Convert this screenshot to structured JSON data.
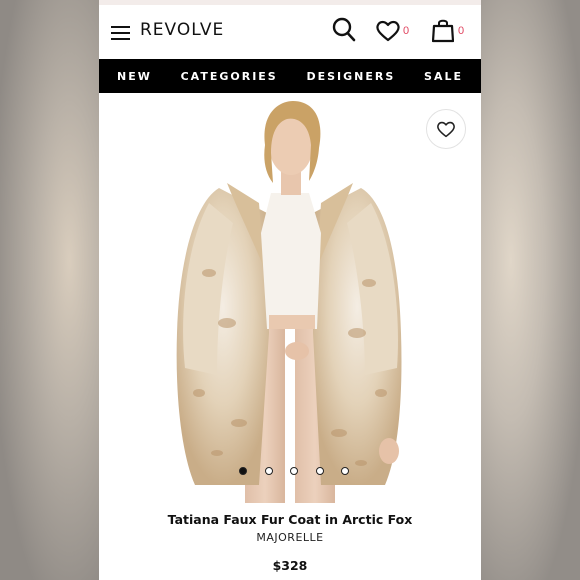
{
  "header": {
    "brand": "REVOLVE",
    "wishlist_count": "0",
    "bag_count": "0"
  },
  "nav": {
    "items": [
      "NEW",
      "CATEGORIES",
      "DESIGNERS",
      "SALE"
    ]
  },
  "product": {
    "title": "Tatiana Faux Fur Coat in Arctic Fox",
    "designer": "MAJORELLE",
    "price": "$328",
    "image_count": 5,
    "active_image_index": 0
  },
  "colors": {
    "accent": "#e0445f",
    "nav_bg": "#000000",
    "text": "#111111"
  },
  "icons": [
    "menu-icon",
    "search-icon",
    "heart-icon",
    "shopping-bag-icon"
  ]
}
